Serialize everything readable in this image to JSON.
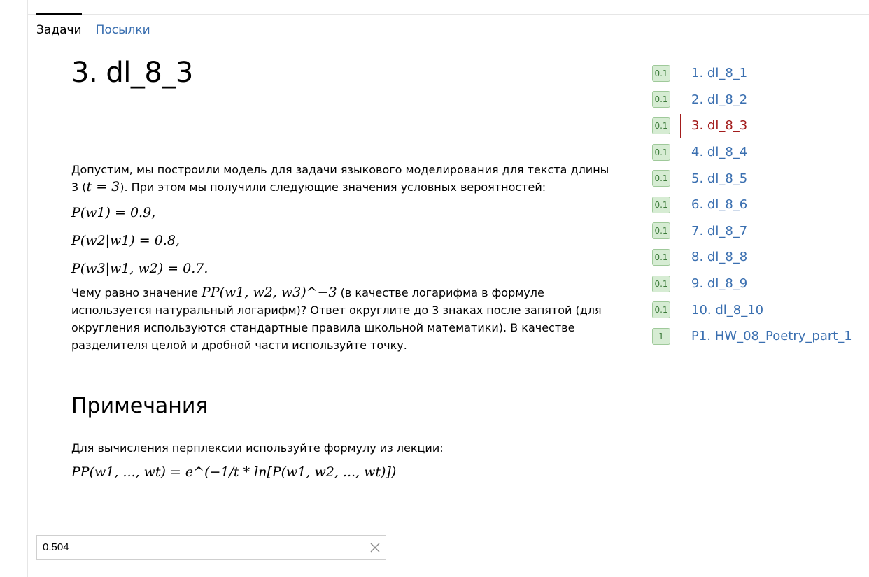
{
  "tabs": [
    {
      "label": "Задачи",
      "active": true
    },
    {
      "label": "Посылки",
      "active": false
    }
  ],
  "problem": {
    "title": "3. dl_8_3",
    "intro_part1": "Допустим, мы построили модель для задачи языкового моделирования для текста длины 3 (",
    "intro_math": "t = 3",
    "intro_part2": "). При этом мы получили следующие значения условных вероятностей:",
    "formulas": [
      "P(w1) = 0.9,",
      "P(w2|w1) = 0.8,",
      "P(w3|w1, w2) = 0.7."
    ],
    "question_part1": "Чему равно значение ",
    "question_math": "PP(w1, w2, w3)^−3",
    "question_part2": " (в качестве логарифма в формуле используется натуральный логарифм)? Ответ округлите до 3 знаках после запятой (для округления используются стандартные правила школьной математики). В качестве разделителя целой и дробной части используйте точку."
  },
  "notes": {
    "title": "Примечания",
    "text": "Для вычисления перплексии используйте формулу из лекции:",
    "formula": "PP(w1, ..., wt) = e^(−1/t * ln[P(w1, w2, ..., wt)])"
  },
  "answer": {
    "value": "0.504"
  },
  "icons": {
    "clear": "close-icon"
  },
  "colors": {
    "link": "#3a6fb0",
    "current": "#a31c1c",
    "badge_bg": "#d6ecd3",
    "badge_text": "#3c7a3a"
  },
  "tasks": [
    {
      "score": "0.1",
      "label": "1. dl_8_1",
      "current": false
    },
    {
      "score": "0.1",
      "label": "2. dl_8_2",
      "current": false
    },
    {
      "score": "0.1",
      "label": "3. dl_8_3",
      "current": true
    },
    {
      "score": "0.1",
      "label": "4. dl_8_4",
      "current": false
    },
    {
      "score": "0.1",
      "label": "5. dl_8_5",
      "current": false
    },
    {
      "score": "0.1",
      "label": "6. dl_8_6",
      "current": false
    },
    {
      "score": "0.1",
      "label": "7. dl_8_7",
      "current": false
    },
    {
      "score": "0.1",
      "label": "8. dl_8_8",
      "current": false
    },
    {
      "score": "0.1",
      "label": "9. dl_8_9",
      "current": false
    },
    {
      "score": "0.1",
      "label": "10. dl_8_10",
      "current": false
    },
    {
      "score": "1",
      "label": "P1. HW_08_Poetry_part_1",
      "current": false
    }
  ]
}
